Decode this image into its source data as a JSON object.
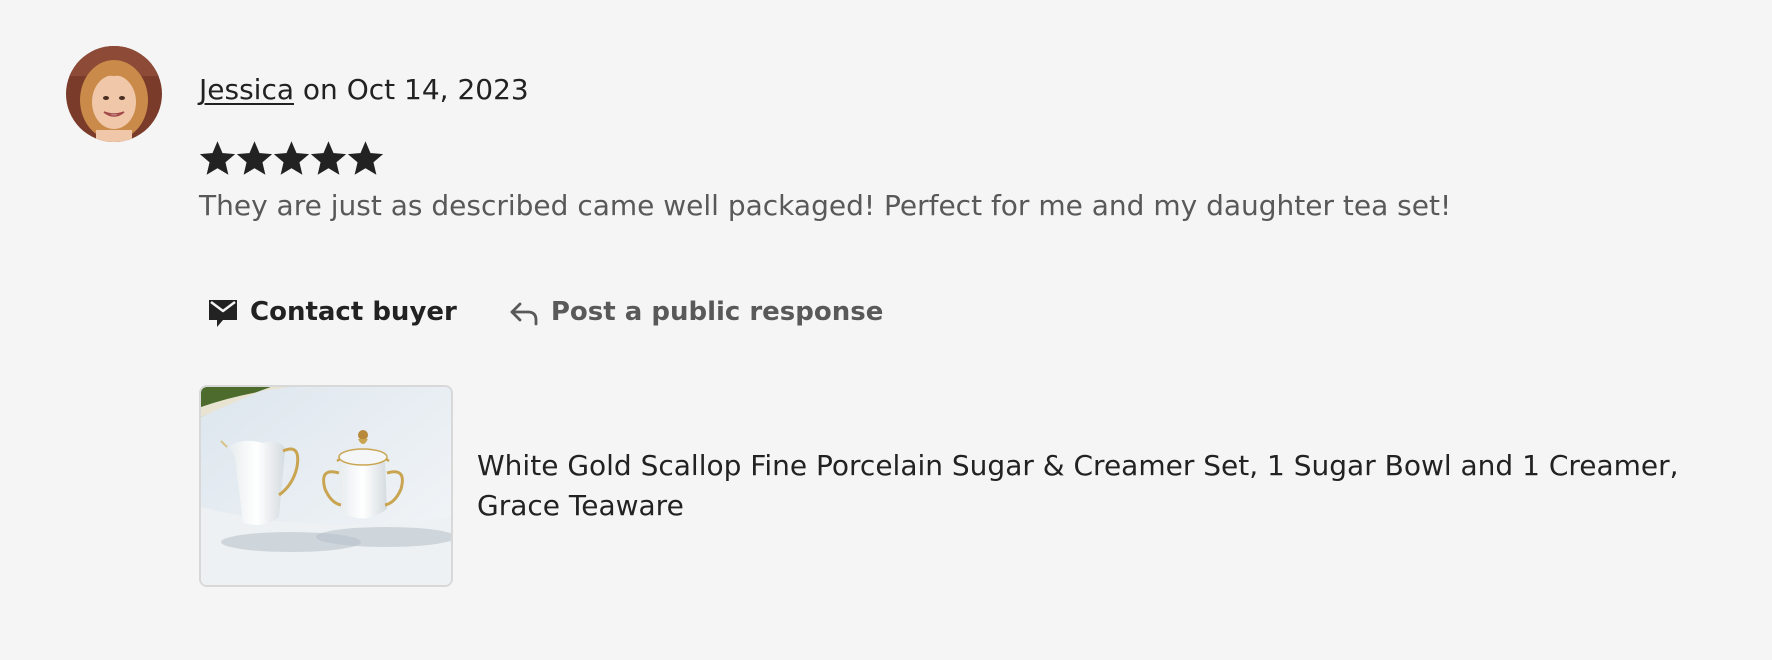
{
  "review": {
    "reviewer_name": "Jessica",
    "date_prefix": "on",
    "date": "Oct 14, 2023",
    "rating": 5,
    "rating_max": 5,
    "text": "They are just as described came well packaged! Perfect for me and my daughter tea set!"
  },
  "actions": {
    "contact_label": "Contact buyer",
    "public_response_label": "Post a public response"
  },
  "product": {
    "title": "White Gold Scallop Fine Porcelain Sugar & Creamer Set, 1 Sugar Bowl and 1 Creamer, Grace Teaware"
  },
  "colors": {
    "text_primary": "#222222",
    "text_secondary": "#595959",
    "star": "#222222",
    "background": "#f5f5f5"
  },
  "icons": {
    "contact": "envelope-chat-icon",
    "public_response": "reply-arrow-icon",
    "star": "star-icon"
  }
}
